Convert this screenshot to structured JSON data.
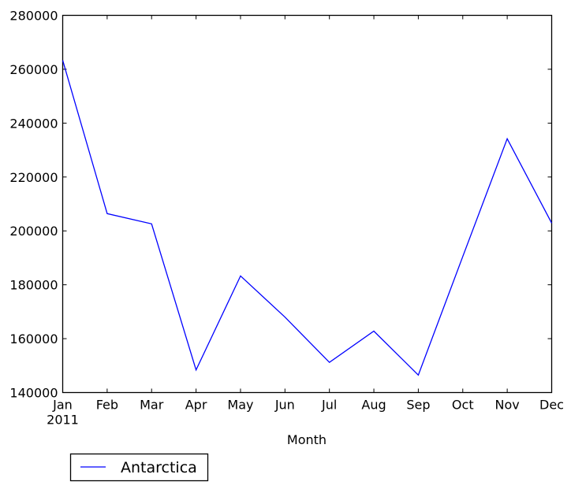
{
  "chart_data": {
    "type": "line",
    "title": "",
    "xlabel": "Month",
    "ylabel": "",
    "categories": [
      "Jan",
      "Feb",
      "Mar",
      "Apr",
      "May",
      "Jun",
      "Jul",
      "Aug",
      "Sep",
      "Oct",
      "Nov",
      "Dec"
    ],
    "x_sublabel": {
      "index": 0,
      "text": "2011"
    },
    "ylim": [
      140000,
      280000
    ],
    "yticks": [
      140000,
      160000,
      180000,
      200000,
      220000,
      240000,
      260000,
      280000
    ],
    "ytick_labels": [
      "140000",
      "160000",
      "180000",
      "200000",
      "220000",
      "240000",
      "260000",
      "280000"
    ],
    "grid": false,
    "legend": {
      "placement": "bottom-left, below axes",
      "entries": [
        "Antarctica"
      ]
    },
    "series": [
      {
        "name": "Antarctica",
        "color": "#0000ff",
        "values": [
          263300,
          206400,
          202600,
          148400,
          183300,
          168000,
          151200,
          162800,
          146500,
          190500,
          234200,
          202900
        ]
      }
    ]
  }
}
